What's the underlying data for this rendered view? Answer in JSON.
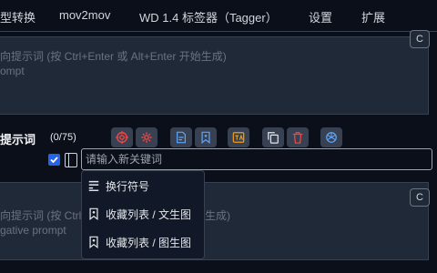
{
  "tabs": [
    "型转换",
    "mov2mov",
    "WD 1.4 标签器（Tagger）",
    "设置",
    "扩展"
  ],
  "prompt": {
    "placeholder_line1": "向提示词 (按 Ctrl+Enter 或 Alt+Enter 开始生成)",
    "placeholder_line2": "ompt",
    "copy_label": "C"
  },
  "prompt_tools": {
    "label": "提示词",
    "count": "(0/75)",
    "keyword_placeholder": "请输入新关键词",
    "icons": [
      "target-icon",
      "gear-icon",
      "file-edit-icon",
      "bookmark-icon",
      "translate-icon",
      "copy-icon",
      "delete-icon",
      "openai-icon"
    ]
  },
  "dropdown": {
    "items": [
      "换行符号",
      "收藏列表 / 文生图",
      "收藏列表 / 图生图"
    ]
  },
  "negative": {
    "placeholder_line1": "向提示词 (按 Ctrl+E",
    "placeholder_line1_tail": "生成)",
    "placeholder_line2": "gative prompt",
    "copy_label": "C"
  },
  "colors": {
    "red": "#ef4444",
    "blue": "#60a5fa",
    "orange": "#f59e0b",
    "accent": "#2563eb"
  }
}
